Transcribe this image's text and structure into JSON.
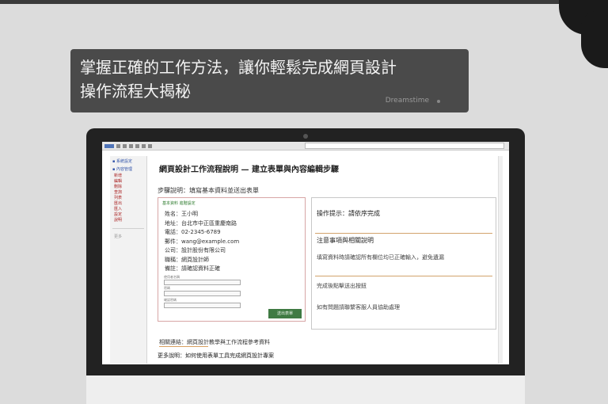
{
  "caption": {
    "line1": "掌握正確的工作方法，讓你輕鬆完成網頁設計",
    "line2": "操作流程大揭秘 ",
    "watermark": "Dreamstime"
  },
  "browser": {
    "address": ""
  },
  "sidebar": {
    "header": [
      "▪ 系統設定",
      "▪ 內容管理"
    ],
    "items": [
      "新增",
      "編輯",
      "刪除",
      "查詢",
      "列表",
      "匯出",
      "匯入",
      "設定",
      "說明"
    ],
    "footer": "更多"
  },
  "main": {
    "page_title": "網頁設計工作流程說明 — 建立表單與內容編輯步驟",
    "subtitle": "步驟說明：填寫基本資料並送出表單",
    "form_panel": {
      "tabs": "基本資料   進階設定",
      "lines": [
        "姓名：王小明",
        "地址：台北市中正區重慶南路",
        "電話：02-2345-6789",
        "郵件：wang@example.com",
        "公司：設計股份有限公司",
        "職稱：網頁設計師",
        "備註：請確認資料正確"
      ],
      "field_labels": [
        "使用者名稱",
        "密碼",
        "確認密碼"
      ],
      "submit_label": "送出表單"
    },
    "info_panel": {
      "line1": "操作提示：請依序完成",
      "line2": "注意事項與相關說明",
      "line3": "填寫資料時請確認所有欄位均已正確輸入，避免遺漏",
      "line4": "完成後點擊送出按鈕",
      "line5": "如有問題請聯繫客服人員協助處理"
    },
    "bottom_line1": "相關連結：網頁設計教學與工作流程參考資料",
    "bottom_line2": "更多說明：如何使用表單工具完成網頁設計專案"
  }
}
